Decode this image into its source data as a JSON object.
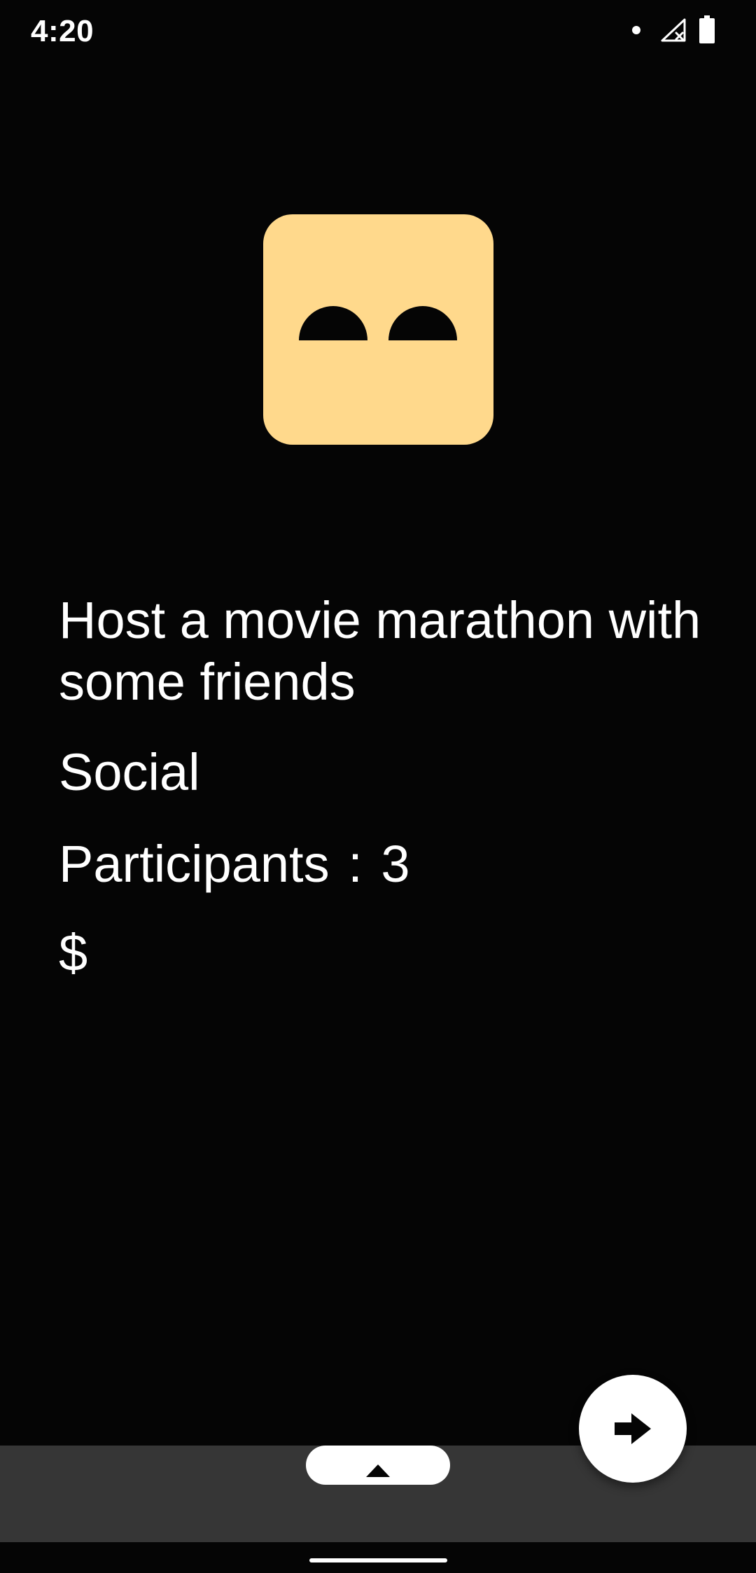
{
  "status_bar": {
    "time": "4:20",
    "icons": [
      "notification-dot-icon",
      "signal-off-icon",
      "battery-icon"
    ]
  },
  "activity": {
    "icon": "face-eyes-icon",
    "title": "Host a movie marathon with some friends",
    "type": "Social",
    "participants_label": "Participants",
    "participants_separator": ":",
    "participants_value": "3",
    "price": "$"
  },
  "actions": {
    "next_icon": "arrow-right-icon",
    "sheet_icon": "chevron-up-icon"
  },
  "colors": {
    "background": "#050505",
    "icon_background": "#ffd98c",
    "bottom_sheet": "#363636",
    "text": "#ffffff"
  }
}
